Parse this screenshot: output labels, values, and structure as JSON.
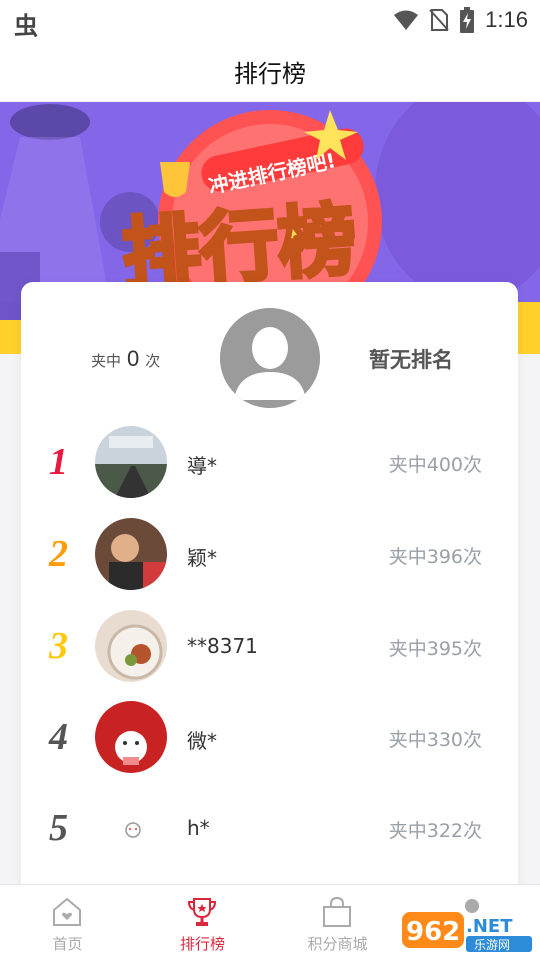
{
  "status_bar": {
    "app_icon": "虫",
    "time": "1:16",
    "icons": [
      "wifi-icon",
      "no-sim-icon",
      "battery-charging-icon"
    ]
  },
  "header": {
    "title": "排行榜"
  },
  "banner": {
    "badge_text": "冲进排行榜吧!",
    "headline": "排行榜",
    "colors": {
      "bg": "#8b6cf0",
      "headline": "#ffd94a",
      "badge": "#ff3b3b"
    }
  },
  "me": {
    "count_prefix": "夹中",
    "count_value": "0",
    "count_suffix": "次",
    "rank_text": "暂无排名"
  },
  "ranking": [
    {
      "rank": "1",
      "name": "導*",
      "count": "夹中400次",
      "color": "#e8183e"
    },
    {
      "rank": "2",
      "name": "颖*",
      "count": "夹中396次",
      "color": "#ff9c0a"
    },
    {
      "rank": "3",
      "name": "**8371",
      "count": "夹中395次",
      "color": "#ffc90a"
    },
    {
      "rank": "4",
      "name": "微*",
      "count": "夹中330次",
      "color": "#555555"
    },
    {
      "rank": "5",
      "name": "h*",
      "count": "夹中322次",
      "color": "#555555"
    }
  ],
  "nav": [
    {
      "label": "首页",
      "icon": "home-icon",
      "active": false
    },
    {
      "label": "排行榜",
      "icon": "trophy-icon",
      "active": true
    },
    {
      "label": "积分商城",
      "icon": "shopping-bag-icon",
      "active": false
    },
    {
      "label": "",
      "icon": "profile-icon",
      "active": false
    }
  ],
  "watermark": {
    "text": "962.NET",
    "subtext": "乐游网"
  }
}
